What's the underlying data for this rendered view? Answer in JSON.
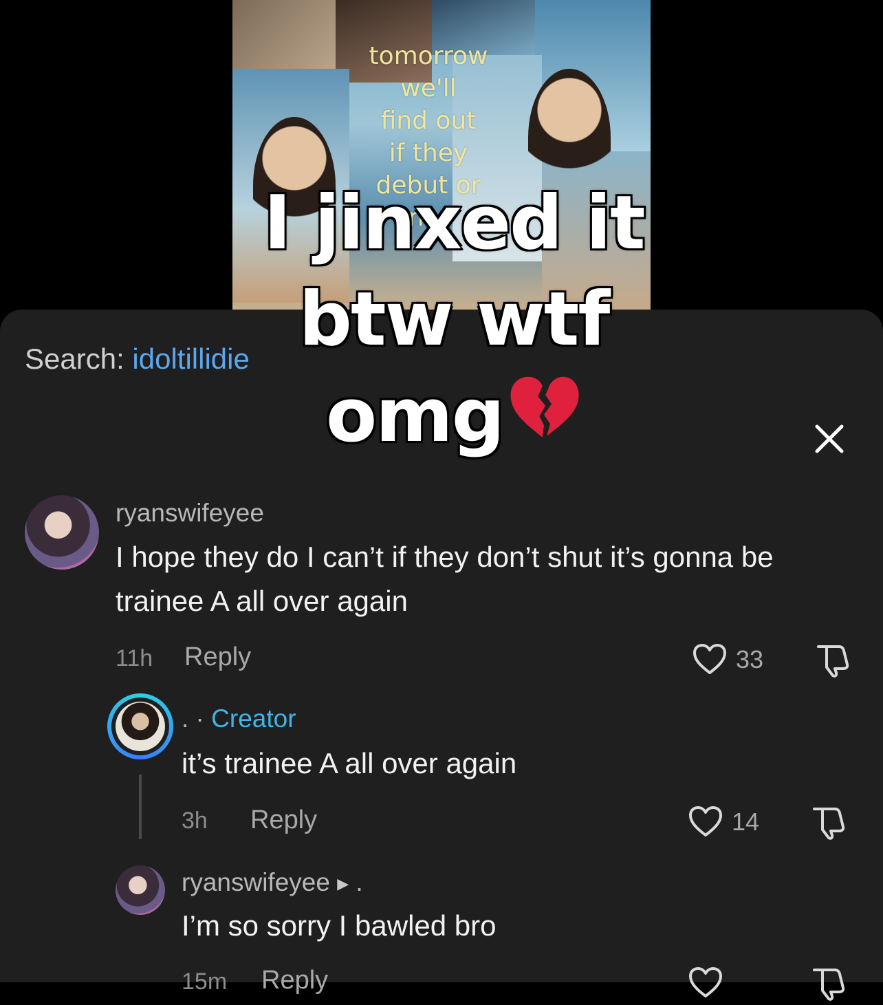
{
  "video": {
    "thumbnail_text": [
      "tomorrow we'll",
      "find out",
      "if they",
      "debut or",
      "not"
    ],
    "overlay_lines": [
      "I jinxed it",
      "btw wtf",
      "omg"
    ],
    "overlay_emoji": "broken-heart-emoji"
  },
  "search": {
    "prefix": "Search:",
    "term": "idoltillidie"
  },
  "comments": [
    {
      "username": "ryanswifeyee",
      "text": "I hope they do I can’t if they don’t shut it’s gonna be trainee A all over again",
      "time": "11h",
      "reply_label": "Reply",
      "likes": "33"
    },
    {
      "username_prefix": ". ·",
      "badge": "Creator",
      "text": "it’s trainee A all over again",
      "time": "3h",
      "reply_label": "Reply",
      "likes": "14"
    },
    {
      "username": "ryanswifeyee",
      "suffix": ".",
      "text": "I’m so sorry I bawled bro",
      "time": "15m",
      "reply_label": "Reply"
    }
  ],
  "icons": {
    "close": "close-icon",
    "like": "heart-outline-icon",
    "dislike": "thumbs-down-icon"
  },
  "colors": {
    "sheet_bg": "#1f1f1f",
    "link_blue": "#5aa8f2",
    "creator_blue": "#3fb5e8"
  }
}
